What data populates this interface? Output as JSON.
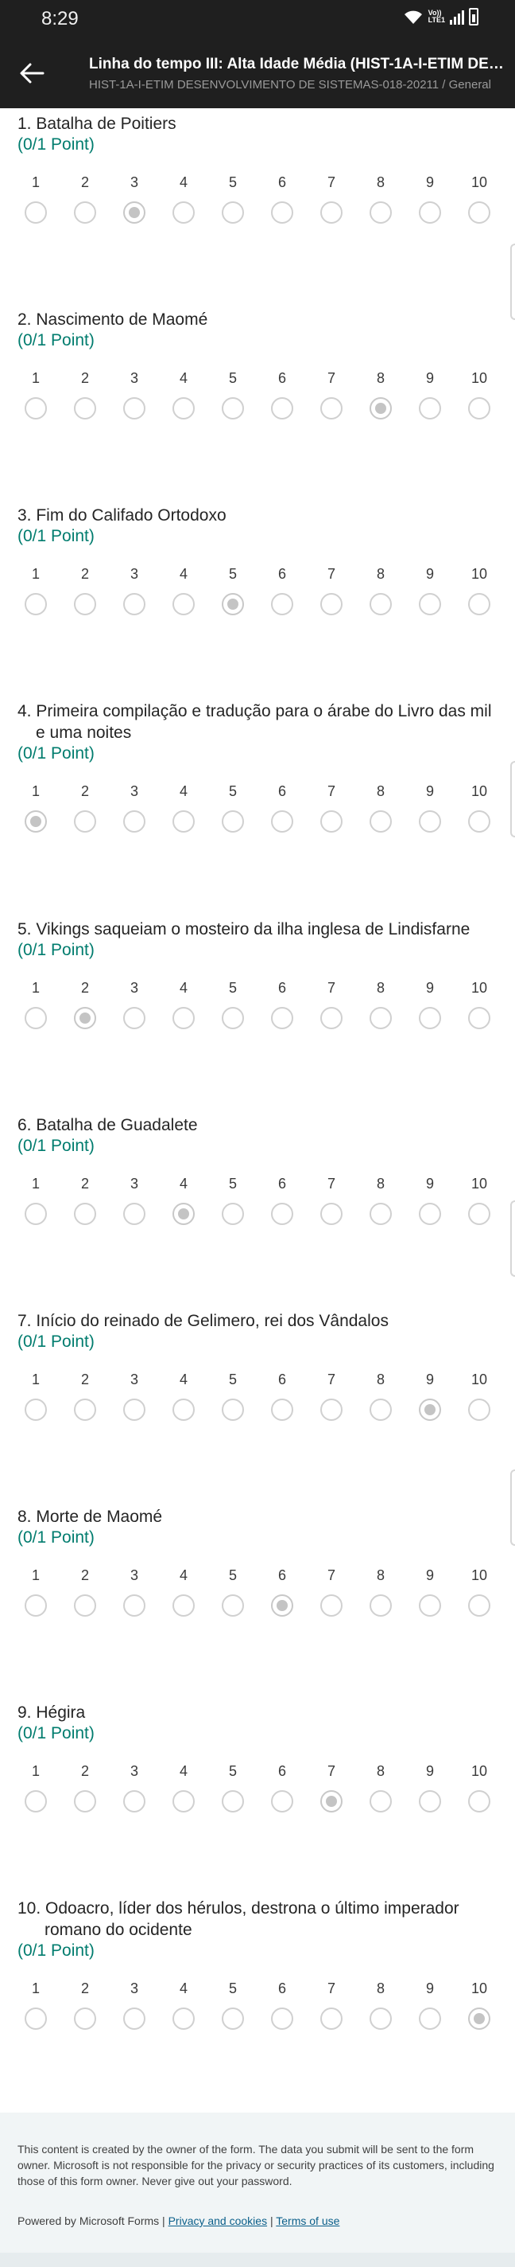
{
  "status_bar": {
    "time": "8:29",
    "network_label_1": "Vo))",
    "network_label_2": "LTE1"
  },
  "header": {
    "back_icon": "arrow-left-icon",
    "title": "Linha do tempo III: Alta Idade Média (HIST-1A-I-ETIM DES...",
    "subtitle": "HIST-1A-I-ETIM DESENVOLVIMENTO DE SISTEMAS-018-20211 / General"
  },
  "scale_labels": [
    "1",
    "2",
    "3",
    "4",
    "5",
    "6",
    "7",
    "8",
    "9",
    "10"
  ],
  "questions": [
    {
      "num": "1.",
      "text": "Batalha de Poitiers",
      "points": "(0/1 Point)",
      "selected": 3
    },
    {
      "num": "2.",
      "text": "Nascimento de Maomé",
      "points": "(0/1 Point)",
      "selected": 8
    },
    {
      "num": "3.",
      "text": "Fim do Califado Ortodoxo",
      "points": "(0/1 Point)",
      "selected": 5
    },
    {
      "num": "4.",
      "text": "Primeira compilação e tradução para o árabe do Livro das mil e uma noites",
      "points": "(0/1 Point)",
      "selected": 1
    },
    {
      "num": "5.",
      "text": "Vikings saqueiam o mosteiro da ilha inglesa de Lindisfarne",
      "points": "(0/1 Point)",
      "selected": 2
    },
    {
      "num": "6.",
      "text": "Batalha de Guadalete",
      "points": "(0/1 Point)",
      "selected": 4
    },
    {
      "num": "7.",
      "text": "Início do reinado de Gelimero, rei dos Vândalos",
      "points": "(0/1 Point)",
      "selected": 9
    },
    {
      "num": "8.",
      "text": "Morte de Maomé",
      "points": "(0/1 Point)",
      "selected": 6
    },
    {
      "num": "9.",
      "text": "Hégira",
      "points": "(0/1 Point)",
      "selected": 7
    },
    {
      "num": "10.",
      "text": "Odoacro, líder dos hérulos, destrona o último imperador romano do ocidente",
      "points": "(0/1 Point)",
      "selected": 10
    }
  ],
  "footer": {
    "disclaimer": "This content is created by the owner of the form. The data you submit will be sent to the form owner. Microsoft is not responsible for the privacy or security practices of its customers, including those of this form owner. Never give out your password.",
    "powered_by": "Powered by Microsoft Forms |",
    "privacy_link": "Privacy and cookies",
    "separator": "|",
    "terms_link": "Terms of use"
  }
}
